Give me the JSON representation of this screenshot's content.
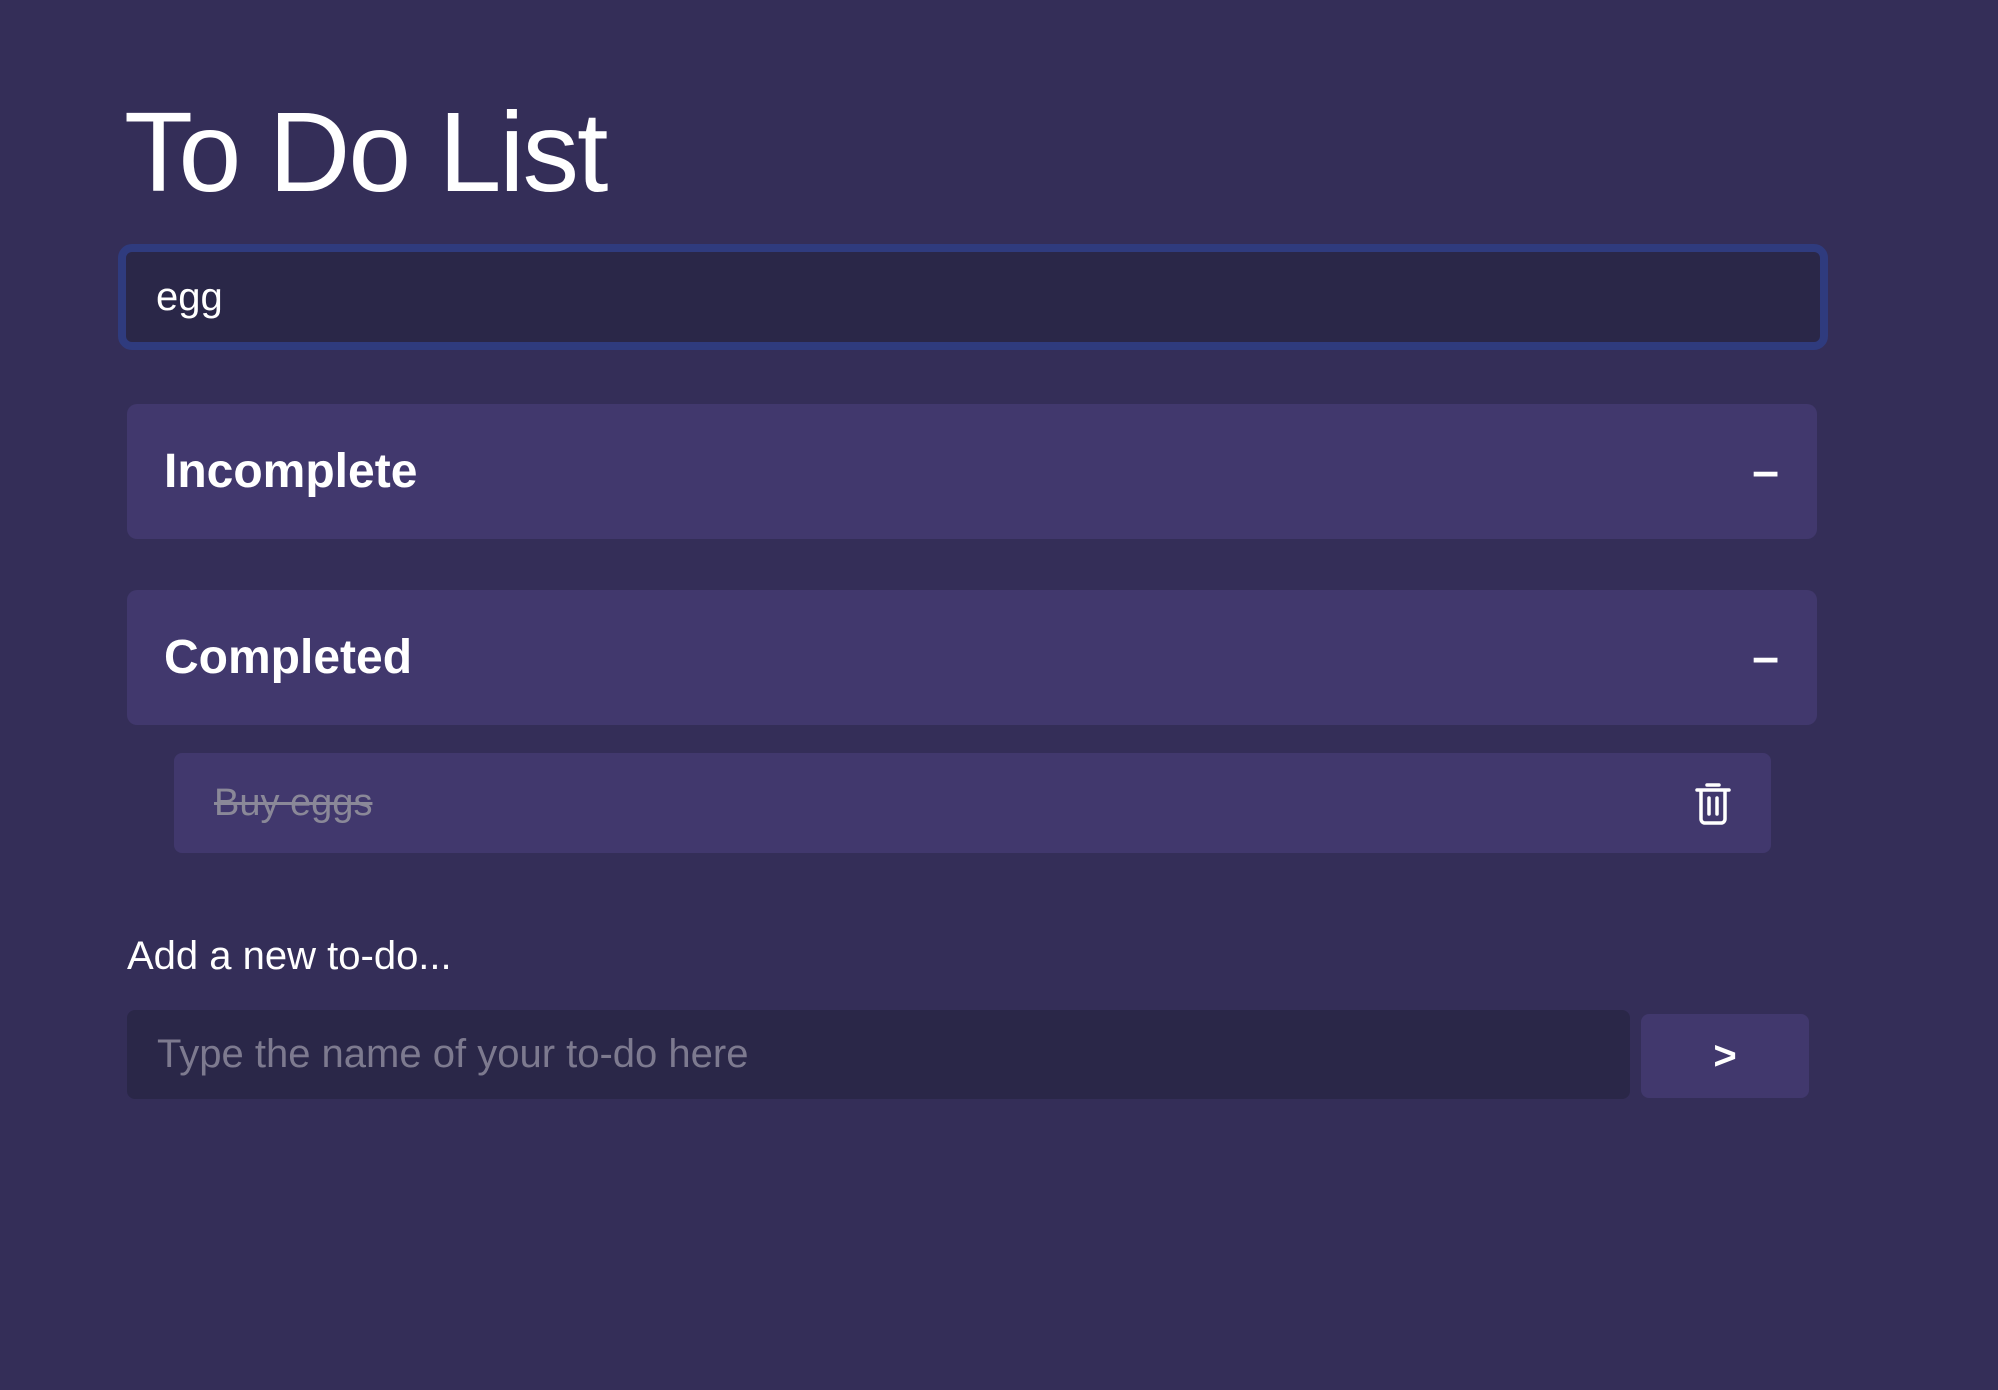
{
  "header": {
    "title": "To Do List"
  },
  "search": {
    "value": "egg"
  },
  "sections": {
    "incomplete": {
      "title": "Incomplete",
      "toggle": "–"
    },
    "completed": {
      "title": "Completed",
      "toggle": "–",
      "items": [
        {
          "text": "Buy eggs",
          "done": true,
          "icon": "trash-icon"
        }
      ]
    }
  },
  "add_form": {
    "label": "Add a new to-do...",
    "placeholder": "Type the name of your to-do here",
    "value": "",
    "submit_label": ">"
  },
  "colors": {
    "background": "#342e58",
    "panel": "#41386d",
    "input_bg": "#2a2748",
    "focus_ring": "#2f3b7e",
    "muted_text": "#8a8898"
  }
}
